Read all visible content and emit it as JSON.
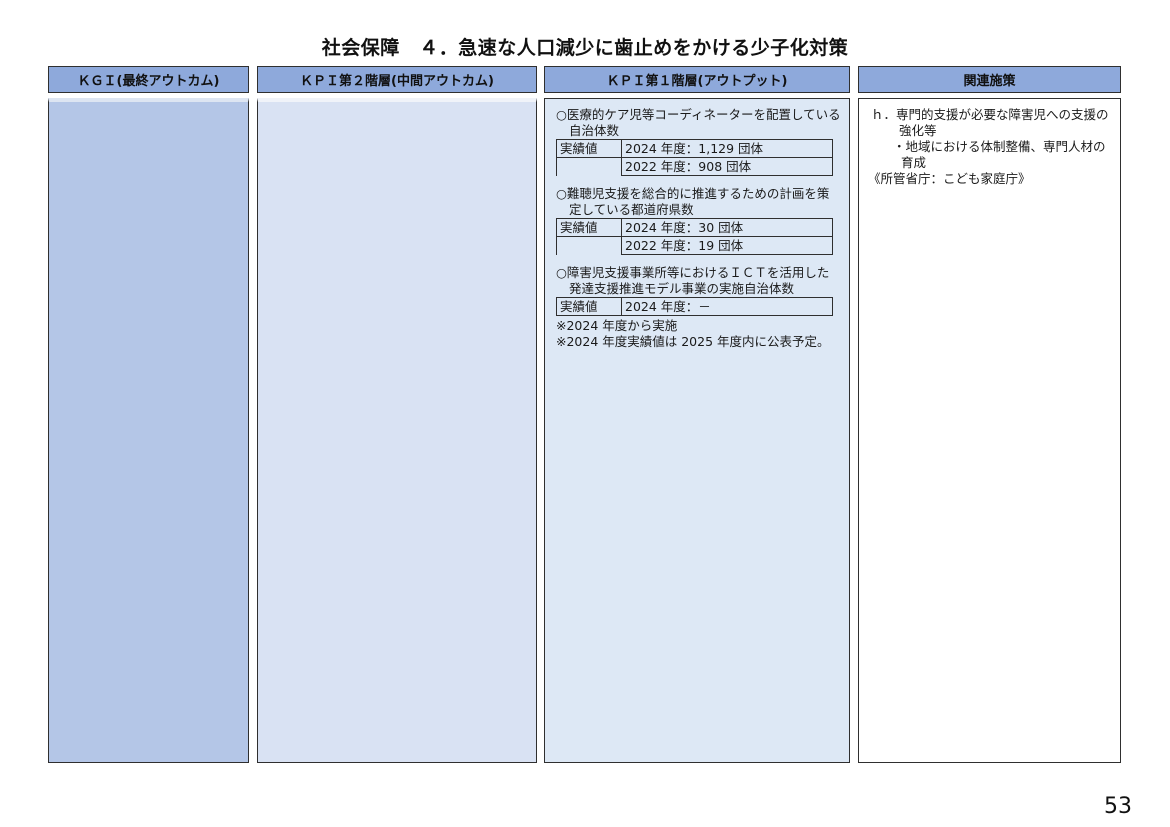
{
  "title": "社会保障　４．急速な人口減少に歯止めをかける少子化対策",
  "headers": {
    "kgi": "ＫＧＩ(最終アウトカム)",
    "kpi2": "ＫＰＩ第２階層(中間アウトカム)",
    "kpi1": "ＫＰＩ第１階層(アウトプット)",
    "policy": "関連施策"
  },
  "kpi1": {
    "items": [
      {
        "label": "○医療的ケア児等コーディネーターを配置している自治体数",
        "result_key": "実績値",
        "results": [
          "2024 年度：1,129 団体",
          "2022 年度：908 団体"
        ]
      },
      {
        "label": "○難聴児支援を総合的に推進するための計画を策定している都道府県数",
        "result_key": "実績値",
        "results": [
          "2024 年度：30 団体",
          "2022 年度：19 団体"
        ]
      },
      {
        "label": "○障害児支援事業所等におけるＩＣＴを活用した発達支援推進モデル事業の実施自治体数",
        "result_key": "実績値",
        "results": [
          "2024 年度：－"
        ]
      }
    ],
    "notes": [
      "※2024 年度から実施",
      "※2024 年度実績値は 2025 年度内に公表予定。"
    ]
  },
  "policy": {
    "heading": "ｈ．専門的支援が必要な障害児への支援の強化等",
    "sub": "・地域における体制整備、専門人材の育成",
    "agency": "《所管省庁：こども家庭庁》"
  },
  "page_number": "53"
}
